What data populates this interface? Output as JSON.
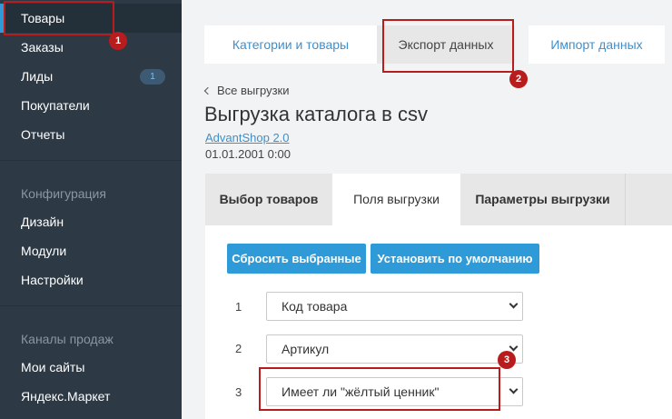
{
  "sidebar": {
    "items": [
      {
        "label": "Товары"
      },
      {
        "label": "Заказы"
      },
      {
        "label": "Лиды",
        "badge": "1"
      },
      {
        "label": "Покупатели"
      },
      {
        "label": "Отчеты"
      }
    ],
    "config_title": "Конфигурация",
    "config_items": [
      {
        "label": "Дизайн"
      },
      {
        "label": "Модули"
      },
      {
        "label": "Настройки"
      }
    ],
    "channels_title": "Каналы продаж",
    "channels_items": [
      {
        "label": "Мои сайты"
      },
      {
        "label": "Яндекс.Маркет"
      }
    ]
  },
  "top_tabs": [
    {
      "label": "Категории и товары"
    },
    {
      "label": "Экспорт данных"
    },
    {
      "label": "Импорт данных"
    }
  ],
  "back_link": "Все выгрузки",
  "page_title": "Выгрузка каталога в csv",
  "sub_link": "AdvantShop 2.0",
  "date": "01.01.2001 0:00",
  "inner_tabs": [
    {
      "label": "Выбор товаров"
    },
    {
      "label": "Поля выгрузки"
    },
    {
      "label": "Параметры выгрузки"
    }
  ],
  "buttons": {
    "reset": "Сбросить выбранные",
    "default": "Установить по умолчанию"
  },
  "fields": [
    {
      "num": "1",
      "value": "Код товара"
    },
    {
      "num": "2",
      "value": "Артикул"
    },
    {
      "num": "3",
      "value": "Имеет ли \"жёлтый ценник\""
    }
  ],
  "annotations": [
    "1",
    "2",
    "3"
  ],
  "colors": {
    "sidebar_bg": "#2d3a46",
    "accent": "#2e9ad8",
    "link": "#3f8fcc",
    "highlight": "#b81c1c"
  }
}
